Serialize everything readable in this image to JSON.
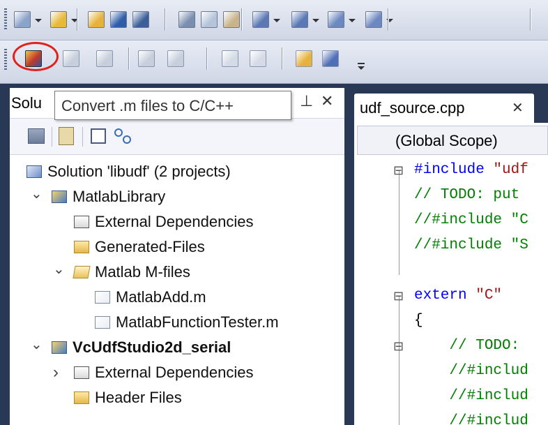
{
  "toolbar": {
    "row1_icons": [
      "new-project-icon",
      "add-item-icon",
      "open-file-icon",
      "save-icon",
      "save-all-icon",
      "cut-icon",
      "copy-icon",
      "paste-icon",
      "undo-icon",
      "redo-icon",
      "navigate-backward-icon",
      "navigate-forward-icon"
    ],
    "row2_icons": [
      "convert-m-to-cpp-icon",
      "grid-icon",
      "clear-icon",
      "import-icon",
      "export-icon",
      "run-icon",
      "stop-icon",
      "open-folder-icon",
      "tool-icon"
    ]
  },
  "tooltip": {
    "text": "Convert .m files to C/C++"
  },
  "solution_explorer": {
    "title": "Solu",
    "pin_glyph": "ꟼ",
    "close_glyph": "✕",
    "tree": [
      {
        "label": "Solution 'libudf' (2 projects)",
        "icon": "solution-icon",
        "indent": 0,
        "chevron": ""
      },
      {
        "label": "MatlabLibrary",
        "icon": "project-icon",
        "indent": 1,
        "chevron": "v"
      },
      {
        "label": "External Dependencies",
        "icon": "dependencies-icon",
        "indent": 2,
        "chevron": ""
      },
      {
        "label": "Generated-Files",
        "icon": "folder-icon",
        "indent": 2,
        "chevron": ""
      },
      {
        "label": "Matlab M-files",
        "icon": "folder-open-icon",
        "indent": 2,
        "chevron": "v"
      },
      {
        "label": "MatlabAdd.m",
        "icon": "file-icon",
        "indent": 3,
        "chevron": ""
      },
      {
        "label": "MatlabFunctionTester.m",
        "icon": "file-icon",
        "indent": 3,
        "chevron": ""
      },
      {
        "label": "VcUdfStudio2d_serial",
        "icon": "project-icon",
        "indent": 1,
        "chevron": "v",
        "bold": true
      },
      {
        "label": "External Dependencies",
        "icon": "dependencies-icon",
        "indent": 2,
        "chevron": ">"
      },
      {
        "label": "Header Files",
        "icon": "folder-icon",
        "indent": 2,
        "chevron": ""
      }
    ]
  },
  "editor": {
    "tab_label": "udf_source.cpp",
    "tab_close": "✕",
    "scope": "(Global Scope)",
    "lines": [
      {
        "fold": "⊟",
        "parts": [
          {
            "t": "#include ",
            "c": "#0000ff"
          },
          {
            "t": "\"udf",
            "c": "#a31515"
          }
        ]
      },
      {
        "fold": "",
        "parts": [
          {
            "t": "// TODO: put",
            "c": "#008000"
          }
        ]
      },
      {
        "fold": "",
        "parts": [
          {
            "t": "//#include \"C",
            "c": "#008000"
          }
        ]
      },
      {
        "fold": "",
        "parts": [
          {
            "t": "//#include \"S",
            "c": "#008000"
          }
        ]
      },
      {
        "fold": "",
        "parts": []
      },
      {
        "fold": "⊟",
        "parts": [
          {
            "t": "extern ",
            "c": "#0000ff"
          },
          {
            "t": "\"C\"",
            "c": "#a31515"
          }
        ]
      },
      {
        "fold": "",
        "parts": [
          {
            "t": "{",
            "c": "#000000"
          }
        ]
      },
      {
        "fold": "⊟",
        "parts": [
          {
            "t": "    // TODO:",
            "c": "#008000"
          }
        ]
      },
      {
        "fold": "",
        "parts": [
          {
            "t": "    //#includ",
            "c": "#008000"
          }
        ]
      },
      {
        "fold": "",
        "parts": [
          {
            "t": "    //#includ",
            "c": "#008000"
          }
        ]
      },
      {
        "fold": "",
        "parts": [
          {
            "t": "    //#includ",
            "c": "#008000"
          }
        ]
      }
    ]
  },
  "colors": {
    "frame": "#293955",
    "accent": "#ff0000",
    "tooltip_bg": "#ffffff"
  }
}
